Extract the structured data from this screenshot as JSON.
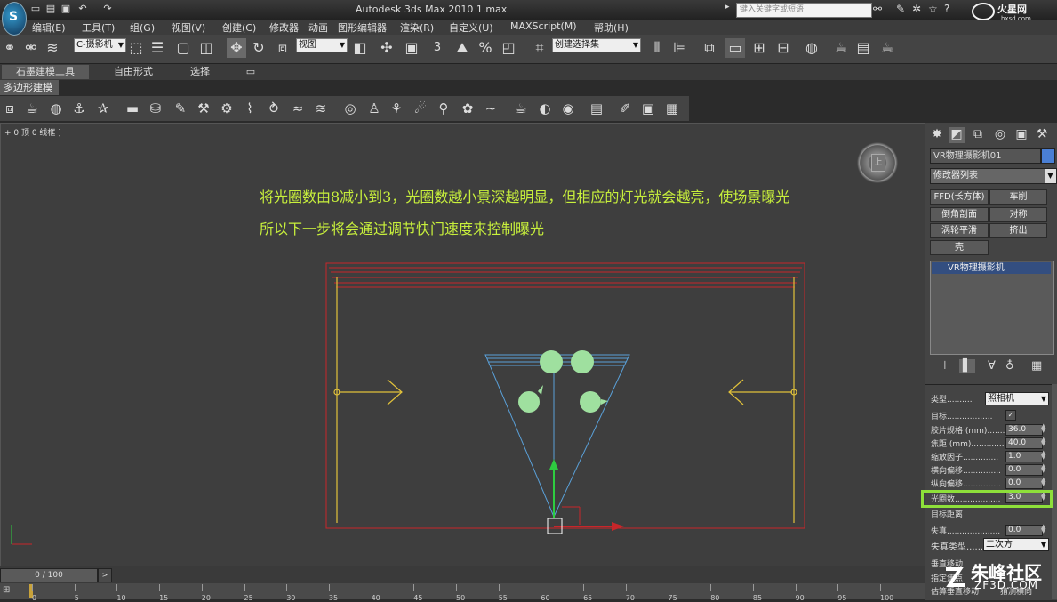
{
  "title_bar": {
    "title": "Autodesk 3ds Max  2010         1.max",
    "search_placeholder": "键入关键字或短语",
    "watermark": "火星网 hxsd.com"
  },
  "menu": [
    "编辑(E)",
    "工具(T)",
    "组(G)",
    "视图(V)",
    "创建(C)",
    "修改器",
    "动画",
    "图形编辑器",
    "渲染(R)",
    "自定义(U)",
    "MAXScript(M)",
    "帮助(H)"
  ],
  "toolbar": {
    "selection_set": "C-摄影机",
    "coordinate_system": "视图",
    "named_selection": "创建选择集",
    "snap_label": "3"
  },
  "ribbon": {
    "tabs": [
      "石墨建模工具",
      "自由形式",
      "选择"
    ],
    "sub_tab": "多边形建模"
  },
  "viewport": {
    "label": "+ 0 顶 0 线框 ]",
    "annotation_line1": "将光圈数由8减小到3，光圈数越小景深越明显，但相应的灯光就会越亮，使场景曝光",
    "annotation_line2": "所以下一步将会通过调节快门速度来控制曝光",
    "nav_cube_face": "上"
  },
  "command_panel": {
    "object_name": "VR物理摄影机01",
    "object_color": "#4a7fd4",
    "modifier_list": "修改器列表",
    "modifier_buttons": [
      "FFD(长方体)",
      "车削",
      "倒角剖面",
      "对称",
      "涡轮平滑",
      "挤出",
      "壳"
    ],
    "stack_item": "VR物理摄影机",
    "params": {
      "type_label": "类型..........",
      "type_value": "照相机",
      "targeted_label": "目标..................",
      "targeted_checked": true,
      "film_gate_label": "胶片规格 (mm).......",
      "film_gate_value": "36.0",
      "focal_length_label": "焦距 (mm).............",
      "focal_length_value": "40.0",
      "zoom_label": "缩放因子..............",
      "zoom_value": "1.0",
      "h_shift_label": "横向偏移...............",
      "h_shift_value": "0.0",
      "v_shift_label": "纵向偏移...............",
      "v_shift_value": "0.0",
      "f_number_label": "光圈数..................",
      "f_number_value": "3.0",
      "target_dist_label": "目标距离",
      "distortion_label": "失真.....................",
      "distortion_value": "0.0",
      "distortion_type_label": "失真类型......",
      "distortion_type_value": "二次方",
      "bottom1": "垂直移动",
      "bottom2": "指定焦点",
      "bottom3": "估算垂直移动",
      "bottom4": "猜测横向"
    }
  },
  "timeline": {
    "slider": "0 / 100",
    "ticks": [
      "0",
      "5",
      "10",
      "15",
      "20",
      "25",
      "30",
      "35",
      "40",
      "45",
      "50",
      "55",
      "60",
      "65",
      "70",
      "75",
      "80",
      "85",
      "90",
      "95",
      "100"
    ]
  },
  "watermark_bottom": {
    "name": "朱峰社区",
    "url": "ZF3D.COM"
  },
  "scene_colors": {
    "room": "#c8262a",
    "wall_lines": "#e2c23a",
    "camera_frustum": "#5aa0d8",
    "lights": "#9fe09f",
    "annotation": "#c8f03c",
    "highlight": "#8ee03a"
  }
}
